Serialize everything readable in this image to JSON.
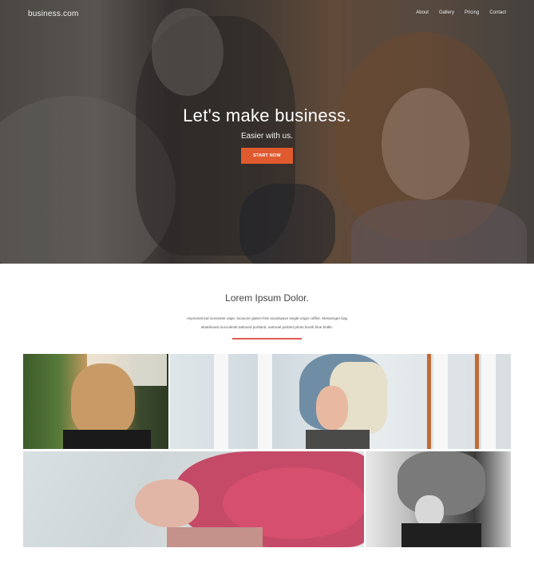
{
  "header": {
    "brand": "business.com",
    "nav": [
      "About",
      "Gallery",
      "Pricing",
      "Contact"
    ]
  },
  "hero": {
    "title": "Let's make business.",
    "subtitle": "Easier with us.",
    "cta_label": "START NOW"
  },
  "intro": {
    "title": "Lorem Ipsum Dolor.",
    "text_line1": "Asymmetrical scenester vape, locavore gluten-free snackwave single-origin coffee. Messenger bag",
    "text_line2": "skateboard succulents tattooed portland, sartorial pickled photo booth blue bottle."
  },
  "colors": {
    "accent": "#e05a2f",
    "underline": "#e05a4e"
  }
}
